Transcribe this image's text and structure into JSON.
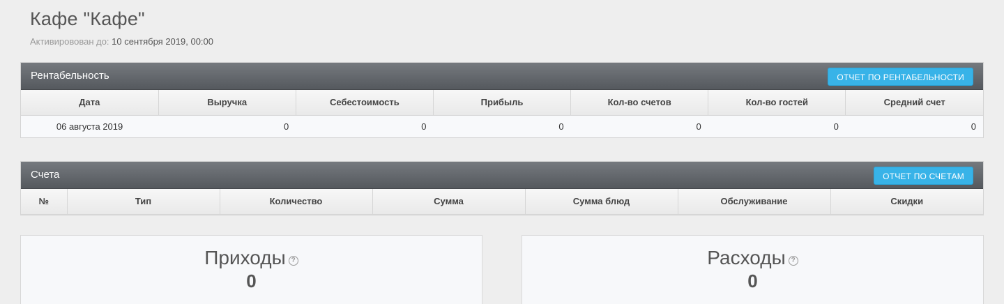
{
  "header": {
    "title": "Кафе \"Кафе\"",
    "activated_label": "Активировован до:",
    "activated_date": "10 сентября 2019, 00:00"
  },
  "profitability": {
    "title": "Рентабельность",
    "report_button": "ОТЧЕТ ПО РЕНТАБЕЛЬНОСТИ",
    "columns": [
      "Дата",
      "Выручка",
      "Себестоимость",
      "Прибыль",
      "Кол-во счетов",
      "Кол-во гостей",
      "Средний счет"
    ],
    "rows": [
      [
        "06 августа 2019",
        "0",
        "0",
        "0",
        "0",
        "0",
        "0"
      ]
    ]
  },
  "bills": {
    "title": "Счета",
    "report_button": "ОТЧЕТ ПО СЧЕТАМ",
    "columns": [
      "№",
      "Тип",
      "Количество",
      "Сумма",
      "Сумма блюд",
      "Обслуживание",
      "Скидки"
    ]
  },
  "income": {
    "title": "Приходы",
    "value": "0"
  },
  "expenses": {
    "title": "Расходы",
    "value": "0"
  }
}
